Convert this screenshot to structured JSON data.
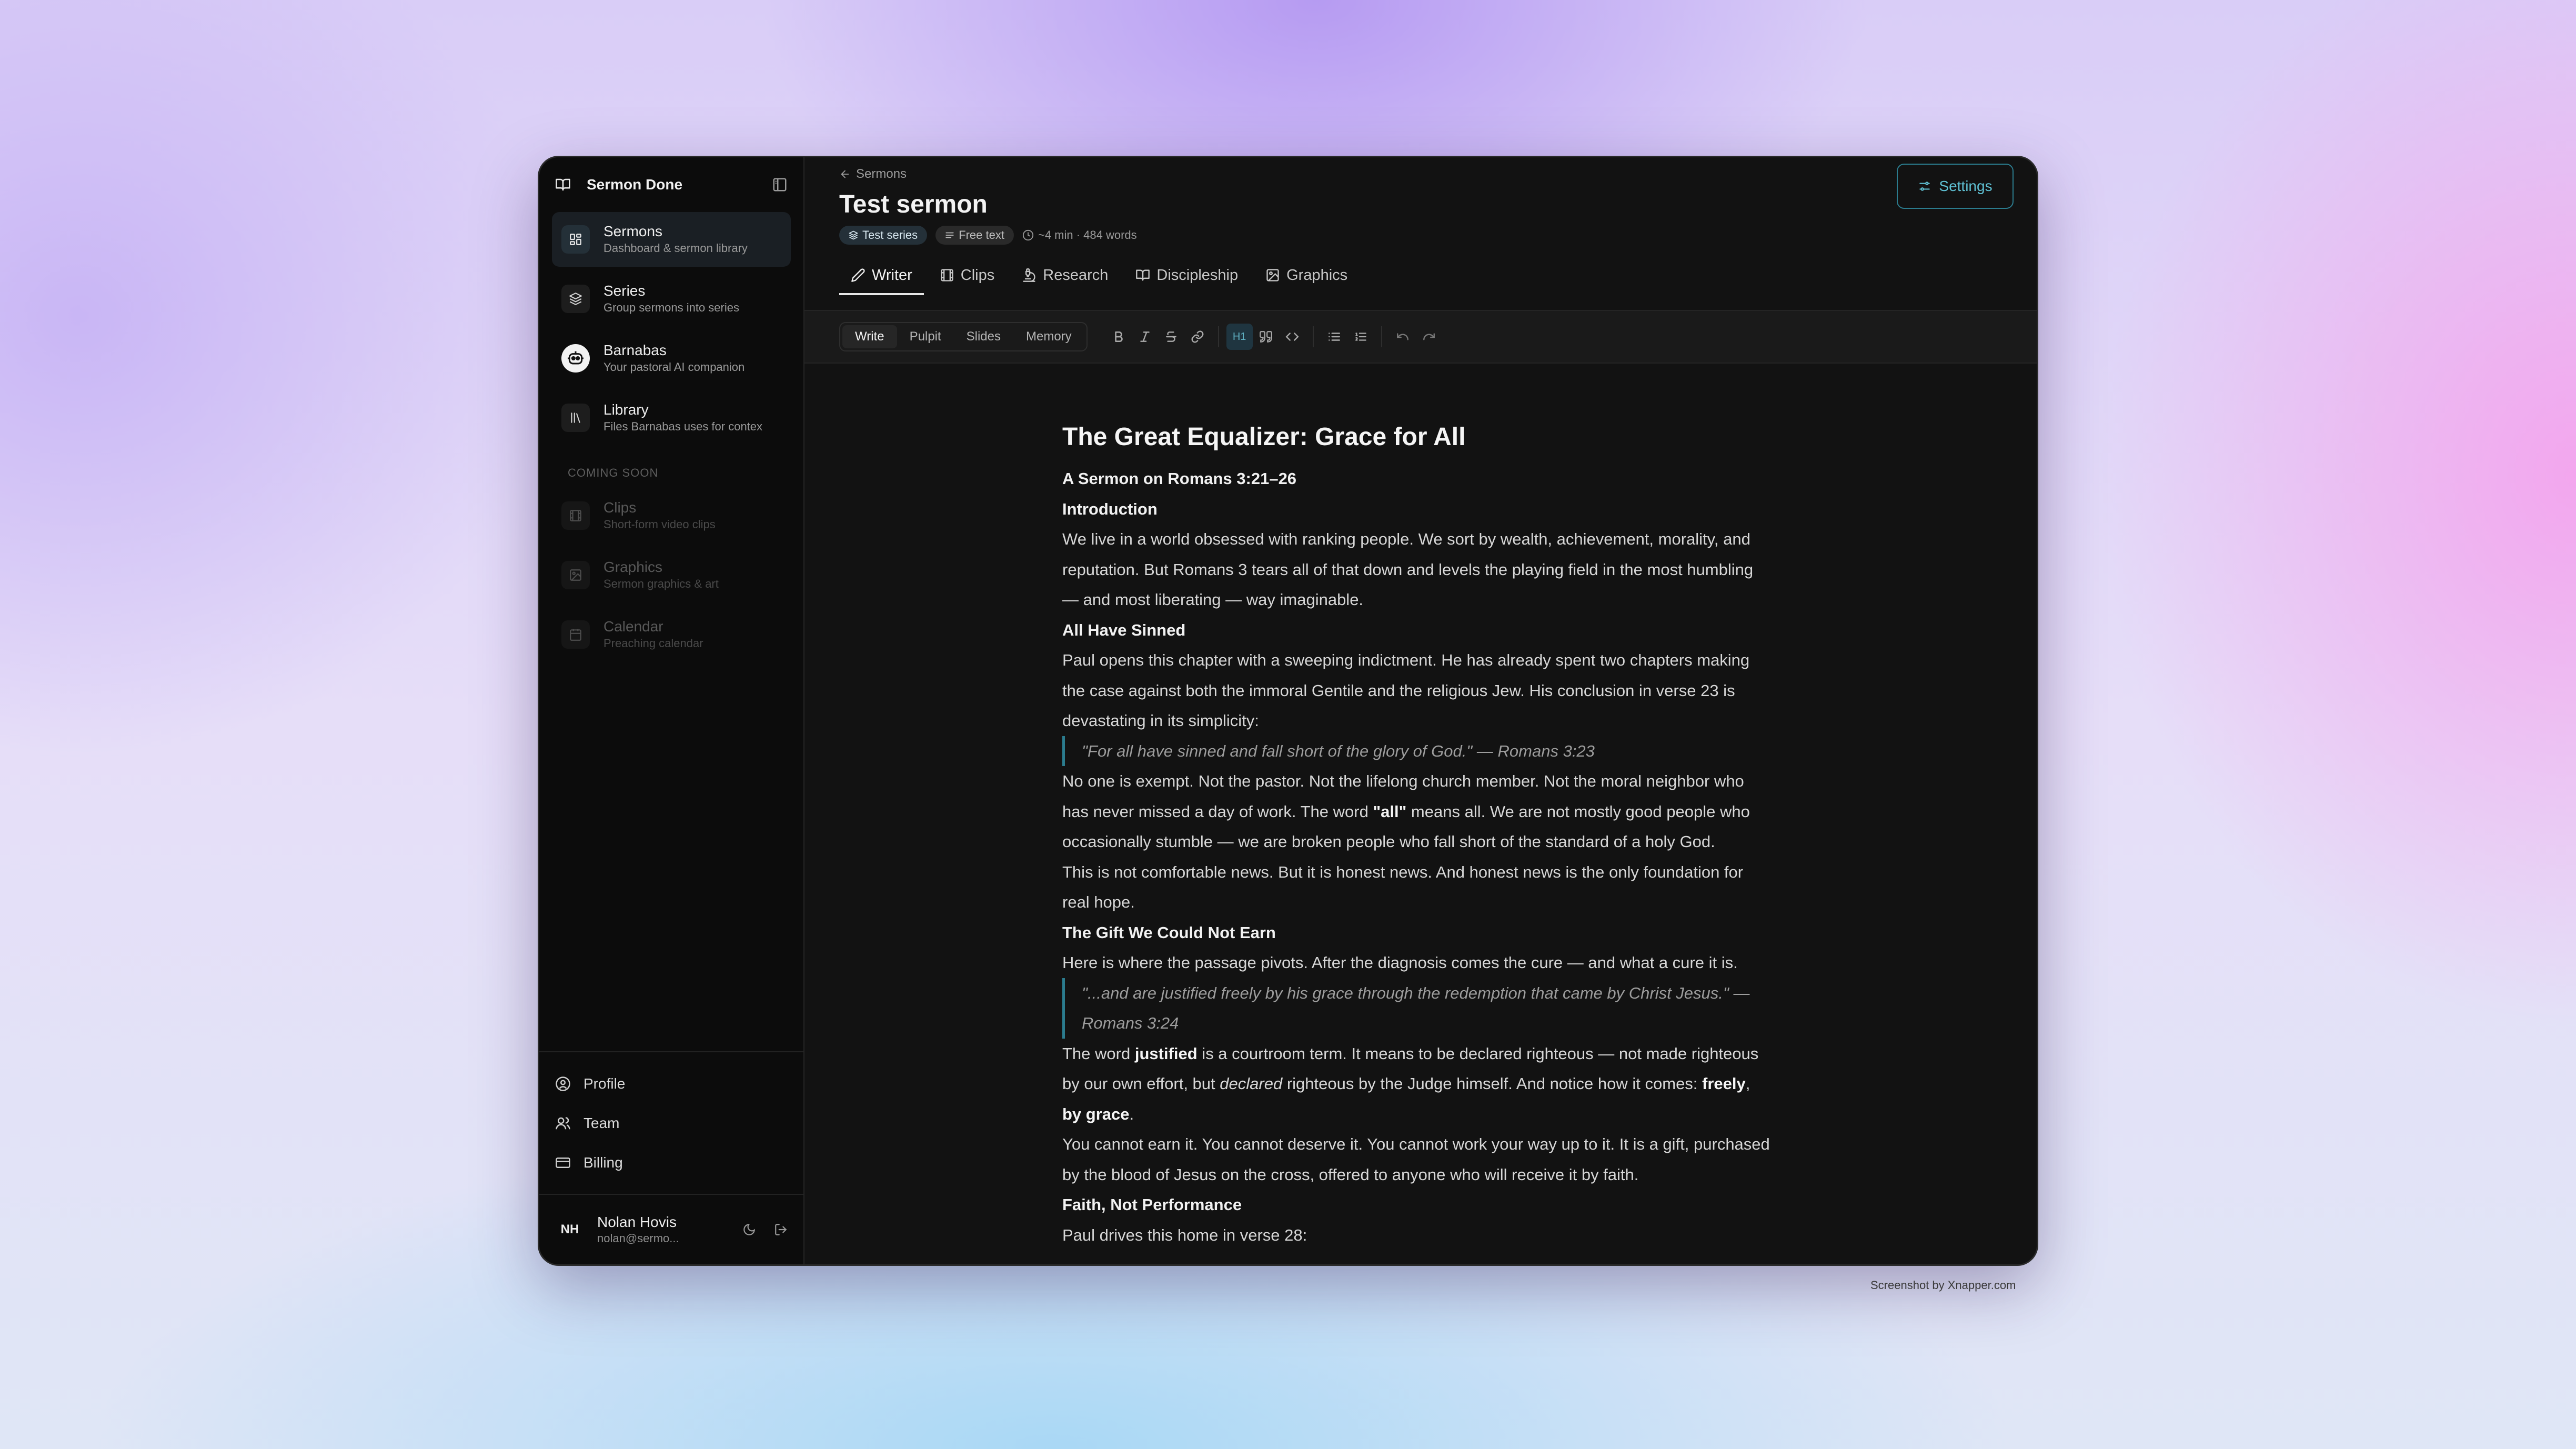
{
  "app": {
    "name": "Sermon Done"
  },
  "sidebar": {
    "items": [
      {
        "label": "Sermons",
        "sub": "Dashboard & sermon library"
      },
      {
        "label": "Series",
        "sub": "Group sermons into series"
      },
      {
        "label": "Barnabas",
        "sub": "Your pastoral AI companion"
      },
      {
        "label": "Library",
        "sub": "Files Barnabas uses for contex"
      }
    ],
    "coming_soon_label": "COMING SOON",
    "coming_soon": [
      {
        "label": "Clips",
        "sub": "Short-form video clips"
      },
      {
        "label": "Graphics",
        "sub": "Sermon graphics & art"
      },
      {
        "label": "Calendar",
        "sub": "Preaching calendar"
      }
    ],
    "links": [
      {
        "label": "Profile"
      },
      {
        "label": "Team"
      },
      {
        "label": "Billing"
      }
    ],
    "user": {
      "initials": "NH",
      "name": "Nolan Hovis",
      "email": "nolan@sermo..."
    }
  },
  "header": {
    "breadcrumb": "Sermons",
    "title": "Test sermon",
    "series_badge": "Test series",
    "text_badge": "Free text",
    "meta": "~4 min · 484 words",
    "settings_label": "Settings",
    "tabs": [
      {
        "label": "Writer"
      },
      {
        "label": "Clips"
      },
      {
        "label": "Research"
      },
      {
        "label": "Discipleship"
      },
      {
        "label": "Graphics"
      }
    ]
  },
  "toolbar": {
    "modes": [
      "Write",
      "Pulpit",
      "Slides",
      "Memory"
    ],
    "heading_label": "H1"
  },
  "document": {
    "title": "The Great Equalizer: Grace for All",
    "subtitle": "A Sermon on Romans 3:21–26",
    "h_intro": "Introduction",
    "p_intro": "We live in a world obsessed with ranking people. We sort by wealth, achievement, morality, and reputation. But Romans 3 tears all of that down and levels the playing field in the most humbling — and most liberating — way imaginable.",
    "h_sinned": "All Have Sinned",
    "p_sinned": "Paul opens this chapter with a sweeping indictment. He has already spent two chapters making the case against both the immoral Gentile and the religious Jew. His conclusion in verse 23 is devastating in its simplicity:",
    "quote1": "\"For all have sinned and fall short of the glory of God.\" — Romans 3:23",
    "p_exempt_a": "No one is exempt. Not the pastor. Not the lifelong church member. Not the moral neighbor who has never missed a day of work. The word ",
    "p_exempt_b": "\"all\"",
    "p_exempt_c": " means all. We are not mostly good people who occasionally stumble — we are broken people who fall short of the standard of a holy God.",
    "p_news": "This is not comfortable news. But it is honest news. And honest news is the only foundation for real hope.",
    "h_gift": "The Gift We Could Not Earn",
    "p_gift": "Here is where the passage pivots. After the diagnosis comes the cure — and what a cure it is.",
    "quote2": "\"...and are justified freely by his grace through the redemption that came by Christ Jesus.\" — Romans 3:24",
    "p_just_a": "The word ",
    "p_just_b": "justified",
    "p_just_c": " is a courtroom term. It means to be declared righteous — not made righteous by our own effort, but ",
    "p_just_d": "declared",
    "p_just_e": " righteous by the Judge himself. And notice how it comes: ",
    "p_just_f": "freely",
    "p_just_g": ", ",
    "p_just_h": "by grace",
    "p_just_i": ".",
    "p_earn": "You cannot earn it. You cannot deserve it. You cannot work your way up to it. It is a gift, purchased by the blood of Jesus on the cross, offered to anyone who will receive it by faith.",
    "h_faith": "Faith, Not Performance",
    "p_faith": "Paul drives this home in verse 28:"
  },
  "watermark": "Screenshot by Xnapper.com",
  "colors": {
    "accent": "#2b7c8e",
    "accent_text": "#5fc1d4",
    "background": "#121212",
    "sidebar": "#0c0c0c"
  }
}
